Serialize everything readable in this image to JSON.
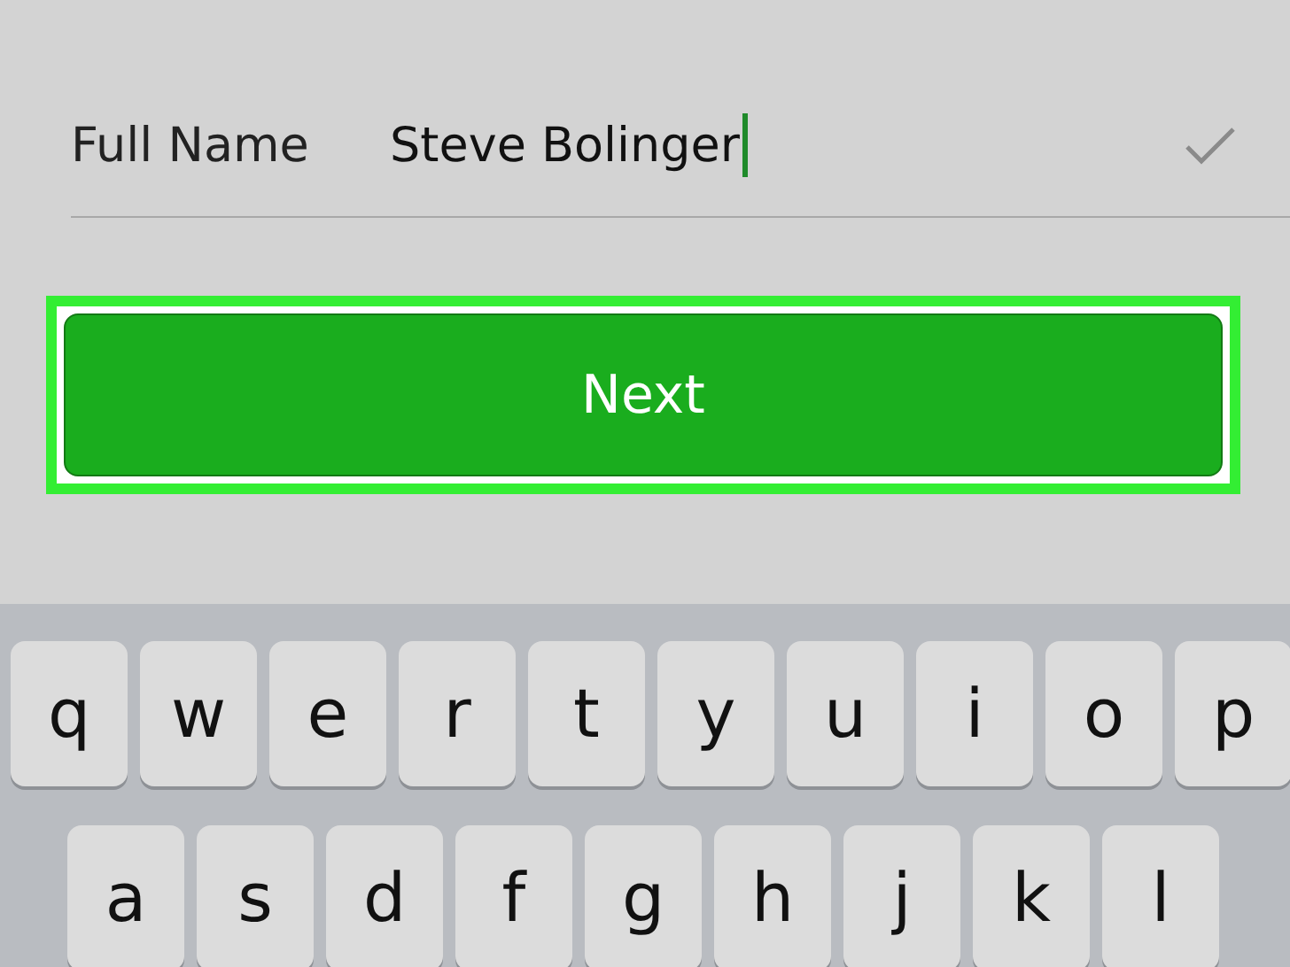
{
  "form": {
    "label": "Full Name",
    "value": "Steve Bolinger",
    "caret": true,
    "valid": true
  },
  "next_button": {
    "label": "Next",
    "highlighted": true
  },
  "keyboard": {
    "rows": [
      [
        "q",
        "w",
        "e",
        "r",
        "t",
        "y",
        "u",
        "i",
        "o",
        "p"
      ],
      [
        "a",
        "s",
        "d",
        "f",
        "g",
        "h",
        "j",
        "k",
        "l"
      ]
    ]
  }
}
